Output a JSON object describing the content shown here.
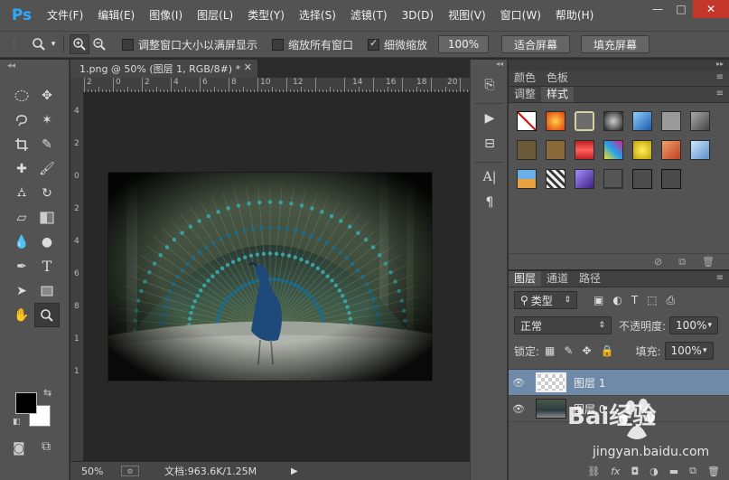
{
  "app": {
    "logo": "Ps"
  },
  "menu": [
    "文件(F)",
    "编辑(E)",
    "图像(I)",
    "图层(L)",
    "类型(Y)",
    "选择(S)",
    "滤镜(T)",
    "3D(D)",
    "视图(V)",
    "窗口(W)",
    "帮助(H)"
  ],
  "window_controls": {
    "minimize": "—",
    "restore": "□",
    "close": "✕"
  },
  "options": {
    "resize_windows": "调整窗口大小以满屏显示",
    "zoom_all": "缩放所有窗口",
    "scrubby_zoom": "细微缩放",
    "zoom_percent": "100%",
    "fit_screen": "适合屏幕",
    "fill_screen": "填充屏幕",
    "resize_checked": false,
    "zoom_all_checked": false,
    "scrubby_checked": true
  },
  "document": {
    "tab_title": "1.png @ 50% (图层 1, RGB/8#) *",
    "ruler_top": [
      "2",
      "0",
      "2",
      "4",
      "6",
      "8",
      "10",
      "12",
      "14",
      "16",
      "18",
      "20"
    ],
    "ruler_left": [
      "4",
      "2",
      "0",
      "2",
      "4",
      "6",
      "8",
      "1",
      "1"
    ],
    "status_zoom": "50%",
    "status_doc": "文档:963.6K/1.25M"
  },
  "panels": {
    "color_tabs": [
      "颜色",
      "色板"
    ],
    "styles_tabs": [
      "调整",
      "样式"
    ],
    "layers_tabs": [
      "图层",
      "通道",
      "路径"
    ],
    "filter_kind": "类型",
    "blend_mode": "正常",
    "opacity_label": "不透明度:",
    "opacity_value": "100%",
    "lock_label": "锁定:",
    "fill_label": "填充:",
    "fill_value": "100%",
    "layers": [
      {
        "name": "图层 1",
        "selected": true
      },
      {
        "name": "图层 0",
        "selected": false
      }
    ]
  },
  "watermark": {
    "brand": "Bai经验",
    "url": "jingyan.baidu.com"
  },
  "colors": {
    "chrome": "#535353",
    "canvas_bg": "#282828",
    "accent_ps": "#31a8ff",
    "selection": "#6e8aa8",
    "close_red": "#c4372b"
  }
}
